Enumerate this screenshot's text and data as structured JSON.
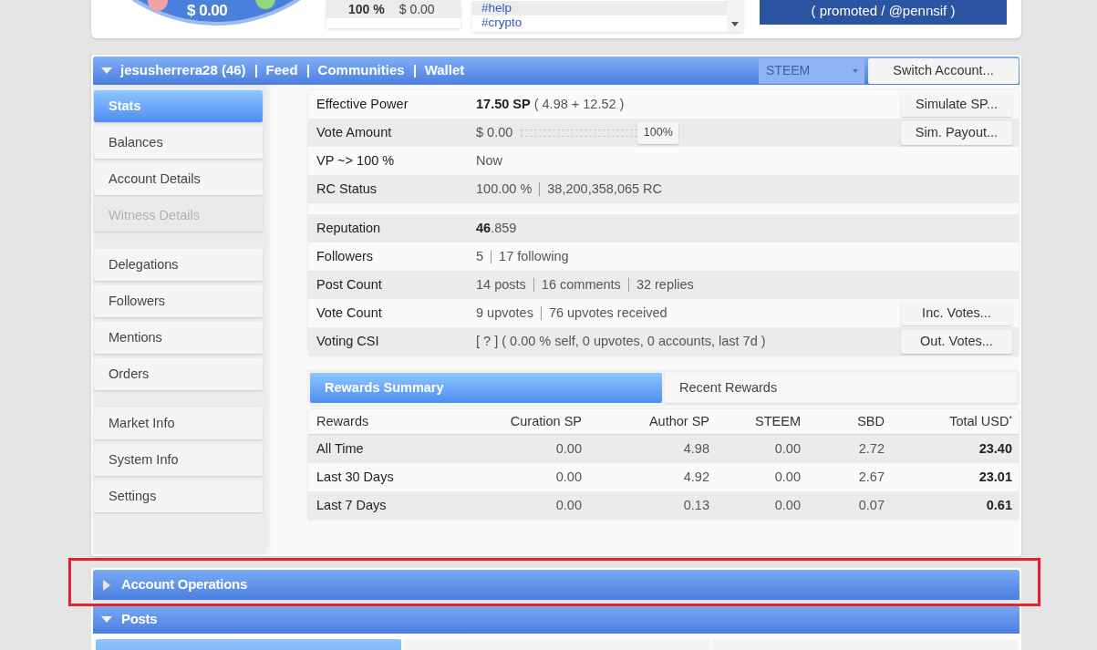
{
  "top_panel": {
    "gauge_value": "$ 0.00",
    "power_row": [
      "100 %",
      "$ 0.00"
    ],
    "tags": [
      {
        "label": "#help",
        "selected": true
      },
      {
        "label": "#crypto",
        "selected": false
      }
    ],
    "promoted_button": "( promoted / @pennsif )"
  },
  "account_panel": {
    "header": {
      "account": "jesusherrera28 (46)",
      "expanded": true,
      "links": [
        "Feed",
        "Communities",
        "Wallet"
      ],
      "currency_select": {
        "value": "STEEM",
        "disabled": true
      },
      "switch_button": "Switch Account..."
    },
    "sidebar": {
      "groups": [
        {
          "items": [
            {
              "label": "Stats",
              "selected": true,
              "disabled": false
            },
            {
              "label": "Balances",
              "selected": false,
              "disabled": false
            },
            {
              "label": "Account Details",
              "selected": false,
              "disabled": false
            },
            {
              "label": "Witness Details",
              "selected": false,
              "disabled": true
            }
          ]
        },
        {
          "items": [
            {
              "label": "Delegations",
              "selected": false,
              "disabled": false
            },
            {
              "label": "Followers",
              "selected": false,
              "disabled": false
            },
            {
              "label": "Mentions",
              "selected": false,
              "disabled": false
            },
            {
              "label": "Orders",
              "selected": false,
              "disabled": false
            }
          ]
        },
        {
          "items": [
            {
              "label": "Market Info",
              "selected": false,
              "disabled": false
            },
            {
              "label": "System Info",
              "selected": false,
              "disabled": false
            },
            {
              "label": "Settings",
              "selected": false,
              "disabled": false
            }
          ]
        }
      ]
    },
    "stats": {
      "groups": [
        {
          "rows": [
            {
              "kind": "text",
              "label": "Effective Power",
              "parts": [
                "**17.50 SP** ( 4.98 + 12.52 )"
              ],
              "button": "Simulate SP..."
            },
            {
              "kind": "slider",
              "label": "Vote Amount",
              "parts": [
                "$ 0.00"
              ],
              "slider": {
                "level": 1,
                "reading": "100%"
              },
              "button": "Sim. Payout..."
            },
            {
              "kind": "text",
              "label": "VP ~> 100 %",
              "parts": [
                "Now"
              ]
            },
            {
              "kind": "text",
              "label": "RC Status",
              "parts": [
                "100.00 %",
                "38,200,358,065 RC"
              ]
            }
          ]
        },
        {
          "rows": [
            {
              "kind": "text",
              "label": "Reputation",
              "parts": [
                "**46**.859"
              ]
            },
            {
              "kind": "text",
              "label": "Followers",
              "parts": [
                "5",
                "17 following"
              ]
            },
            {
              "kind": "text",
              "label": "Post Count",
              "parts": [
                "14 posts",
                "16 comments",
                "32 replies"
              ]
            },
            {
              "kind": "text",
              "label": "Vote Count",
              "parts": [
                "9 upvotes",
                "76 upvotes received"
              ],
              "button": "Inc. Votes..."
            },
            {
              "kind": "text",
              "label": "Voting CSI",
              "parts": [
                "[ ? ] ( 0.00 % self, 0 upvotes, 0 accounts, last 7d )"
              ],
              "button": "Out. Votes..."
            }
          ]
        }
      ]
    },
    "rewards": {
      "tabs": [
        {
          "label": "Rewards Summary",
          "selected": true
        },
        {
          "label": "Recent Rewards",
          "selected": false
        }
      ],
      "columns": [
        "Rewards",
        "Curation SP",
        "Author SP",
        "STEEM",
        "SBD",
        "Total USD$^{*}$"
      ],
      "rows": [
        {
          "label": "All Time",
          "values": [
            "0.00",
            "4.98",
            "0.00",
            "2.72",
            "23.40"
          ]
        },
        {
          "label": "Last 30 Days",
          "values": [
            "0.00",
            "4.92",
            "0.00",
            "2.67",
            "23.01"
          ]
        },
        {
          "label": "Last 7 Days",
          "values": [
            "0.00",
            "0.13",
            "0.00",
            "0.07",
            "0.61"
          ]
        }
      ]
    }
  },
  "sections": [
    {
      "title": "Account Operations",
      "expanded": false,
      "highlighted": true
    },
    {
      "title": "Posts",
      "expanded": true,
      "highlighted": false,
      "tabs": [
        {
          "selected": true
        },
        {
          "selected": false
        },
        {
          "selected": false
        }
      ]
    }
  ]
}
